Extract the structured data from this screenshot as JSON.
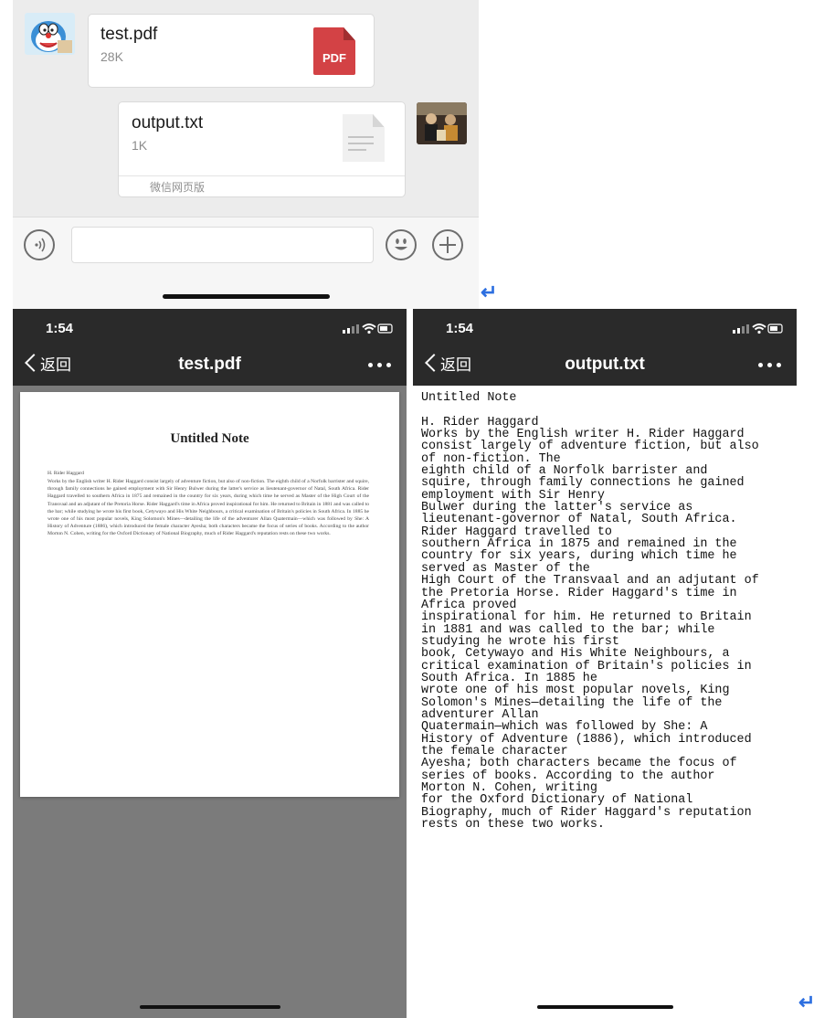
{
  "chat": {
    "messages": [
      {
        "file_name": "test.pdf",
        "file_size": "28K",
        "file_icon": "pdf-file-icon",
        "icon_label": "PDF",
        "side": "left"
      },
      {
        "file_name": "output.txt",
        "file_size": "1K",
        "file_icon": "text-file-icon",
        "source": "微信网页版",
        "side": "right"
      }
    ],
    "input_bar": {
      "buttons": [
        "voice-icon",
        "emoji-icon",
        "plus-icon"
      ]
    }
  },
  "pdf_viewer": {
    "status_time": "1:54",
    "back_label": "返回",
    "title": "test.pdf",
    "document": {
      "heading": "Untitled Note",
      "author": "H. Rider Haggard",
      "body": "Works by the English writer H. Rider Haggard consist largely of adventure fiction, but also of non-fiction. The eighth child of a Norfolk barrister and squire, through family connections he gained employment with Sir Henry Bulwer during the latter's service as lieutenant-governor of Natal, South Africa. Rider Haggard travelled to southern Africa in 1875 and remained in the country for six years, during which time he served as Master of the High Court of the Transvaal and an adjutant of the Pretoria Horse. Rider Haggard's time in Africa proved inspirational for him. He returned to Britain in 1881 and was called to the bar; while studying he wrote his first book, Cetywayo and His White Neighbours, a critical examination of Britain's policies in South Africa. In 1885 he wrote one of his most popular novels, King Solomon's Mines—detailing the life of the adventurer Allan Quatermain—which was followed by She: A History of Adventure (1886), which introduced the female character Ayesha; both characters became the focus of series of books. According to the author Morton N. Cohen, writing for the Oxford Dictionary of National Biography, much of Rider Haggard's reputation rests on these two works."
    }
  },
  "txt_viewer": {
    "status_time": "1:54",
    "back_label": "返回",
    "title": "output.txt",
    "content": "Untitled Note\n\nH. Rider Haggard\nWorks by the English writer H. Rider Haggard\nconsist largely of adventure fiction, but also\nof non-fiction. The\neighth child of a Norfolk barrister and\nsquire, through family connections he gained\nemployment with Sir Henry\nBulwer during the latter's service as\nlieutenant-governor of Natal, South Africa.\nRider Haggard travelled to\nsouthern Africa in 1875 and remained in the\ncountry for six years, during which time he\nserved as Master of the\nHigh Court of the Transvaal and an adjutant of\nthe Pretoria Horse. Rider Haggard's time in\nAfrica proved\ninspirational for him. He returned to Britain\nin 1881 and was called to the bar; while\nstudying he wrote his first\nbook, Cetywayo and His White Neighbours, a\ncritical examination of Britain's policies in\nSouth Africa. In 1885 he\nwrote one of his most popular novels, King\nSolomon's Mines—detailing the life of the\nadventurer Allan\nQuatermain—which was followed by She: A\nHistory of Adventure (1886), which introduced\nthe female character\nAyesha; both characters became the focus of\nseries of books. According to the author\nMorton N. Cohen, writing\nfor the Oxford Dictionary of National\nBiography, much of Rider Haggard's reputation\nrests on these two works."
  },
  "colors": {
    "accent_blue": "#2d6fe0",
    "pdf_red": "#d34245",
    "navbar": "#2a2a2a"
  }
}
